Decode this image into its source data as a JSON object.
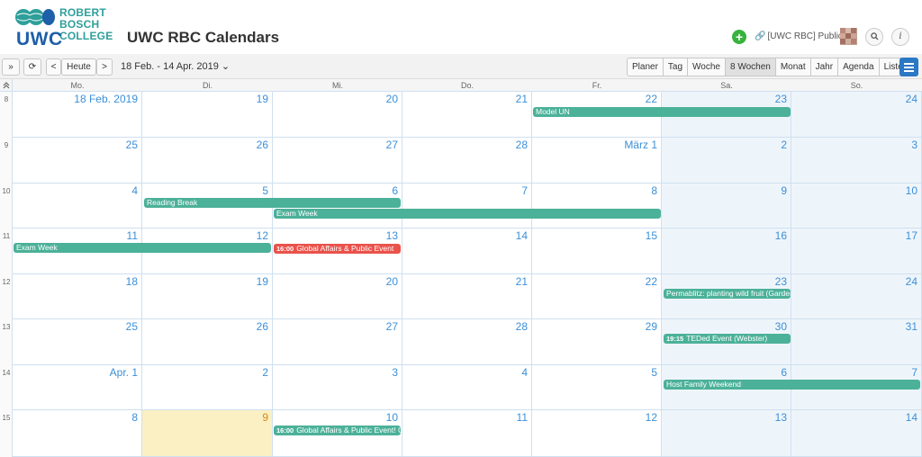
{
  "logo": {
    "lines": "ROBERT\nBOSCH\nCOLLEGE",
    "uwc": "UWC"
  },
  "app_title": "UWC RBC Calendars",
  "header": {
    "add_label": "+",
    "public_label": "[UWC RBC] Public",
    "search_icon": "search-icon",
    "info_label": "i"
  },
  "toolbar": {
    "expand_label": "»",
    "refresh_label": "⟳",
    "prev_label": "<",
    "today_label": "Heute",
    "next_label": ">",
    "date_range": "18 Feb. - 14 Apr. 2019 ⌄",
    "views": [
      "Planer",
      "Tag",
      "Woche",
      "8 Wochen",
      "Monat",
      "Jahr",
      "Agenda",
      "Liste"
    ],
    "active_view": "8 Wochen"
  },
  "day_headers": [
    "Mo.",
    "Di.",
    "Mi.",
    "Do.",
    "Fr.",
    "Sa.",
    "So."
  ],
  "weeks": [
    {
      "num": "8",
      "days": [
        "18 Feb. 2019",
        "19",
        "20",
        "21",
        "22",
        "23",
        "24"
      ]
    },
    {
      "num": "9",
      "days": [
        "25",
        "26",
        "27",
        "28",
        "März 1",
        "2",
        "3"
      ]
    },
    {
      "num": "10",
      "days": [
        "4",
        "5",
        "6",
        "7",
        "8",
        "9",
        "10"
      ]
    },
    {
      "num": "11",
      "days": [
        "11",
        "12",
        "13",
        "14",
        "15",
        "16",
        "17"
      ]
    },
    {
      "num": "12",
      "days": [
        "18",
        "19",
        "20",
        "21",
        "22",
        "23",
        "24"
      ]
    },
    {
      "num": "13",
      "days": [
        "25",
        "26",
        "27",
        "28",
        "29",
        "30",
        "31"
      ]
    },
    {
      "num": "14",
      "days": [
        "Apr. 1",
        "2",
        "3",
        "4",
        "5",
        "6",
        "7"
      ]
    },
    {
      "num": "15",
      "days": [
        "8",
        "9",
        "10",
        "11",
        "12",
        "13",
        "14"
      ]
    }
  ],
  "events": {
    "model_un": "Model UN",
    "reading_break": "Reading Break",
    "exam_week_1": "Exam Week",
    "exam_week_2": "Exam Week",
    "global_affairs_1_time": "16:00",
    "global_affairs_1": "Global Affairs & Public Event",
    "permablitz": "Permablitz: planting wild fruit (Garden)",
    "teded_time": "19:15",
    "teded": "TEDed Event (Webster)",
    "host_family": "Host Family Weekend",
    "global_affairs_2_time": "16:00",
    "global_affairs_2": "Global Affairs & Public Event! Chemie"
  },
  "colors": {
    "event_green": "#4cb199",
    "event_red": "#e9524b",
    "date_blue": "#3b8fd8",
    "today_yellow": "#fbefc4"
  }
}
